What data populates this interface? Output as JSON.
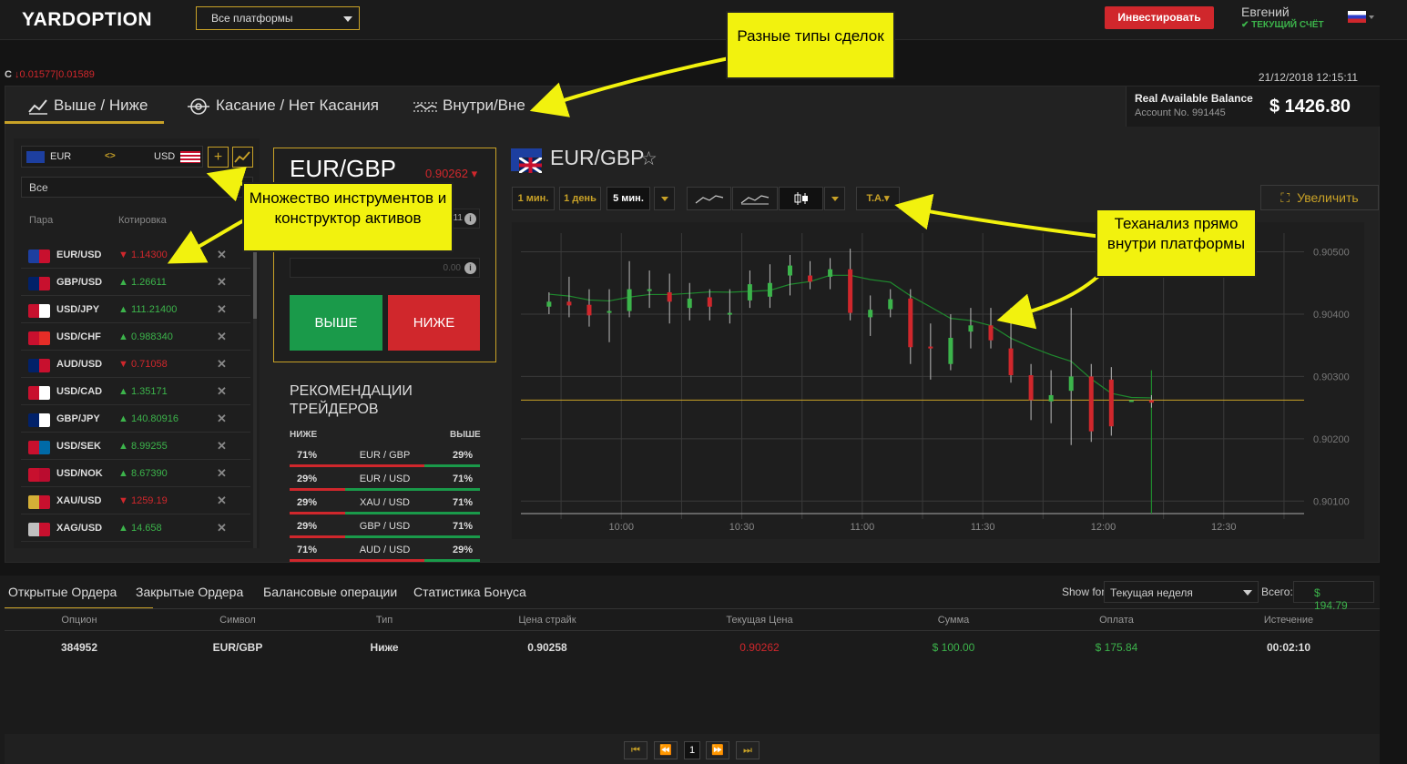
{
  "header": {
    "logo": "YARDOPTION",
    "platform_select": "Все платформы",
    "invest_button": "Инвестировать",
    "user_name": "Евгений",
    "account_type": "✔ ТЕКУЩИЙ СЧЁТ"
  },
  "ticker": {
    "prefix": "C",
    "value": "↓0.01577|0.01589"
  },
  "clock": "21/12/2018 12:15:11",
  "tabs": [
    {
      "label": "Выше / Ниже",
      "icon": "trend-up-icon"
    },
    {
      "label": "Касание / Нет Касания",
      "icon": "target-icon"
    },
    {
      "label": "Внутри/Вне",
      "icon": "range-icon"
    }
  ],
  "balance": {
    "label": "Real Available Balance",
    "account": "Account No. 991445",
    "value": "$ 1426.80"
  },
  "pair_selector": {
    "base": "EUR",
    "swap": "<>",
    "quote": "USD"
  },
  "filter": "Все",
  "asset_table": {
    "headers": [
      "Пара",
      "Котировка"
    ],
    "rows": [
      {
        "pair": "EUR/USD",
        "dir": "down",
        "price": "1.14300",
        "arrow": "▼"
      },
      {
        "pair": "GBP/USD",
        "dir": "up",
        "price": "1.26611",
        "arrow": "▲"
      },
      {
        "pair": "USD/JPY",
        "dir": "up",
        "price": "111.21400",
        "arrow": "▲"
      },
      {
        "pair": "USD/CHF",
        "dir": "up",
        "price": "0.988340",
        "arrow": "▲"
      },
      {
        "pair": "AUD/USD",
        "dir": "down",
        "price": "0.71058",
        "arrow": "▼"
      },
      {
        "pair": "USD/CAD",
        "dir": "up",
        "price": "1.35171",
        "arrow": "▲"
      },
      {
        "pair": "GBP/JPY",
        "dir": "up",
        "price": "140.80916",
        "arrow": "▲"
      },
      {
        "pair": "USD/SEK",
        "dir": "up",
        "price": "8.99255",
        "arrow": "▲"
      },
      {
        "pair": "USD/NOK",
        "dir": "up",
        "price": "8.67390",
        "arrow": "▲"
      },
      {
        "pair": "XAU/USD",
        "dir": "down",
        "price": "1259.19",
        "arrow": "▼"
      },
      {
        "pair": "XAG/USD",
        "dir": "up",
        "price": "14.658",
        "arrow": "▲"
      }
    ]
  },
  "trade_box": {
    "pair": "EUR/GBP",
    "price": "0.90262 ▾",
    "input1_suffix": "11",
    "input2_value": "0.00",
    "up_button": "ВЫШЕ",
    "down_button": "НИЖЕ"
  },
  "recommendations": {
    "title": "РЕКОМЕНДАЦИИ ТРЕЙДЕРОВ",
    "lower": "НИЖЕ",
    "higher": "ВЫШЕ",
    "rows": [
      {
        "down": "71%",
        "pair": "EUR / GBP",
        "up": "29%",
        "down_frac": 0.71
      },
      {
        "down": "29%",
        "pair": "EUR / USD",
        "up": "71%",
        "down_frac": 0.29
      },
      {
        "down": "29%",
        "pair": "XAU / USD",
        "up": "71%",
        "down_frac": 0.29
      },
      {
        "down": "29%",
        "pair": "GBP / USD",
        "up": "71%",
        "down_frac": 0.29
      },
      {
        "down": "71%",
        "pair": "AUD / USD",
        "up": "29%",
        "down_frac": 0.71
      }
    ]
  },
  "chart_toolbar": {
    "tf1": "1 мин.",
    "tf2": "1 день",
    "tf3": "5 мин.",
    "ta": "T.A.▾",
    "zoom": "Увеличить"
  },
  "chart_title": "EUR/GBP",
  "chart_data": {
    "type": "candlestick",
    "x_ticks": [
      "10:00",
      "10:30",
      "11:00",
      "11:30",
      "12:00",
      "12:30"
    ],
    "y_ticks": [
      "0.90500",
      "0.90400",
      "0.90300",
      "0.90200",
      "0.90100"
    ],
    "ylim": [
      0.9008,
      0.9053
    ],
    "current_price_line": 0.90262,
    "candles": [
      {
        "t": "09:42",
        "o": 0.90412,
        "c": 0.9042,
        "h": 0.90435,
        "l": 0.904
      },
      {
        "t": "09:47",
        "o": 0.9042,
        "c": 0.90414,
        "h": 0.9046,
        "l": 0.90395
      },
      {
        "t": "09:52",
        "o": 0.90415,
        "c": 0.90398,
        "h": 0.9044,
        "l": 0.9038
      },
      {
        "t": "09:57",
        "o": 0.90403,
        "c": 0.90405,
        "h": 0.9044,
        "l": 0.90355
      },
      {
        "t": "10:02",
        "o": 0.90405,
        "c": 0.9044,
        "h": 0.90485,
        "l": 0.90395
      },
      {
        "t": "10:07",
        "o": 0.9044,
        "c": 0.9044,
        "h": 0.9047,
        "l": 0.9041
      },
      {
        "t": "10:12",
        "o": 0.90435,
        "c": 0.9042,
        "h": 0.90465,
        "l": 0.90385
      },
      {
        "t": "10:17",
        "o": 0.9041,
        "c": 0.90425,
        "h": 0.9045,
        "l": 0.9039
      },
      {
        "t": "10:22",
        "o": 0.90427,
        "c": 0.90412,
        "h": 0.9044,
        "l": 0.9039
      },
      {
        "t": "10:27",
        "o": 0.904,
        "c": 0.90402,
        "h": 0.9044,
        "l": 0.90385
      },
      {
        "t": "10:32",
        "o": 0.90422,
        "c": 0.90448,
        "h": 0.9047,
        "l": 0.9041
      },
      {
        "t": "10:37",
        "o": 0.90428,
        "c": 0.9045,
        "h": 0.9048,
        "l": 0.9041
      },
      {
        "t": "10:42",
        "o": 0.90462,
        "c": 0.90478,
        "h": 0.90495,
        "l": 0.9043
      },
      {
        "t": "10:47",
        "o": 0.90462,
        "c": 0.90452,
        "h": 0.90485,
        "l": 0.9044
      },
      {
        "t": "10:52",
        "o": 0.9046,
        "c": 0.90472,
        "h": 0.9049,
        "l": 0.9044
      },
      {
        "t": "10:57",
        "o": 0.90472,
        "c": 0.90402,
        "h": 0.90505,
        "l": 0.9039
      },
      {
        "t": "11:02",
        "o": 0.90395,
        "c": 0.90407,
        "h": 0.9043,
        "l": 0.90365
      },
      {
        "t": "11:07",
        "o": 0.90408,
        "c": 0.90424,
        "h": 0.9044,
        "l": 0.90395
      },
      {
        "t": "11:12",
        "o": 0.90425,
        "c": 0.90347,
        "h": 0.9044,
        "l": 0.9032
      },
      {
        "t": "11:17",
        "o": 0.90348,
        "c": 0.90345,
        "h": 0.90385,
        "l": 0.90295
      },
      {
        "t": "11:22",
        "o": 0.9032,
        "c": 0.90362,
        "h": 0.904,
        "l": 0.9031
      },
      {
        "t": "11:27",
        "o": 0.90372,
        "c": 0.90382,
        "h": 0.9041,
        "l": 0.90345
      },
      {
        "t": "11:32",
        "o": 0.90382,
        "c": 0.90358,
        "h": 0.9041,
        "l": 0.90345
      },
      {
        "t": "11:37",
        "o": 0.90345,
        "c": 0.90302,
        "h": 0.9041,
        "l": 0.9029
      },
      {
        "t": "11:42",
        "o": 0.90302,
        "c": 0.90262,
        "h": 0.9032,
        "l": 0.9023
      },
      {
        "t": "11:47",
        "o": 0.9026,
        "c": 0.9027,
        "h": 0.9031,
        "l": 0.90225
      },
      {
        "t": "11:52",
        "o": 0.90277,
        "c": 0.903,
        "h": 0.9041,
        "l": 0.9019
      },
      {
        "t": "11:57",
        "o": 0.903,
        "c": 0.90212,
        "h": 0.9032,
        "l": 0.90195
      },
      {
        "t": "12:02",
        "o": 0.90295,
        "c": 0.9022,
        "h": 0.90315,
        "l": 0.90205
      },
      {
        "t": "12:07",
        "o": 0.90262,
        "c": 0.90262,
        "h": 0.90262,
        "l": 0.90262
      },
      {
        "t": "12:12",
        "o": 0.90262,
        "c": 0.90258,
        "h": 0.9027,
        "l": 0.9025
      }
    ],
    "colors": {
      "up": "#3cb44b",
      "down": "#d0272c",
      "ma": "#1f8a2e",
      "price_line": "#c9a227"
    }
  },
  "bottom_tabs": [
    "Открытые Ордера",
    "Закрытые Ордера",
    "Балансовые операции",
    "Статистика Бонуса"
  ],
  "show_for": {
    "label": "Show for",
    "value": "Текущая неделя",
    "total_label": "Всего:",
    "total_value": "$ 194.79"
  },
  "orders": {
    "headers": [
      "Опцион",
      "Символ",
      "Тип",
      "Цена страйк",
      "Текущая Цена",
      "Сумма",
      "Оплата",
      "Истечение"
    ],
    "rows": [
      [
        "384952",
        "EUR/GBP",
        "Ниже",
        "0.90258",
        "0.90262",
        "$ 100.00",
        "$ 175.84",
        "00:02:10"
      ]
    ]
  },
  "pager": {
    "first": "⏮",
    "prev": "⏪",
    "page": "1",
    "next": "⏩",
    "last": "⏭"
  },
  "callouts": {
    "deal_types": "Разные типы сделок",
    "instruments": "Множество инструментов и конструктор активов",
    "ta": "Теханализ прямо внутри платформы"
  }
}
